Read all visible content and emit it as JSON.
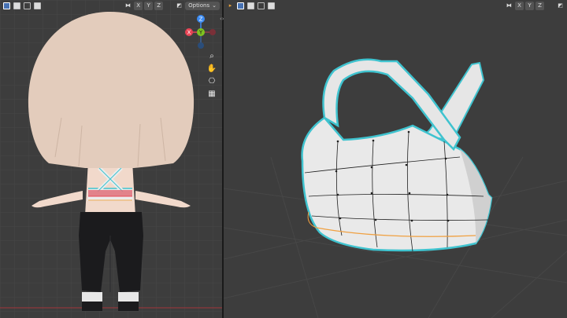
{
  "left_viewport": {
    "header": {
      "axis_labels": [
        "X",
        "Y",
        "Z"
      ],
      "options_label": "Options",
      "options_chevron_icon": "chevron-down-icon"
    },
    "gizmo": {
      "x_label": "X",
      "y_label": "Y",
      "z_label": "Z"
    },
    "nav_icons": [
      "zoom-icon",
      "hand-pan-icon",
      "camera-icon",
      "grid-icon"
    ]
  },
  "right_viewport": {
    "header": {
      "axis_labels": [
        "X",
        "Y",
        "Z"
      ]
    }
  },
  "colors": {
    "viewport_bg": "#3d3d3d",
    "grid_line": "#4a4a4a",
    "edge_highlight": "#3fc3cf",
    "seam_orange": "#f0a040",
    "hair": "#e3ccbc",
    "skin": "#f1d9cb",
    "pants": "#1a1a1c",
    "top_white": "#ececec",
    "x_axis": "#e84354",
    "y_axis": "#7ec321",
    "z_axis": "#3d8cf2"
  }
}
